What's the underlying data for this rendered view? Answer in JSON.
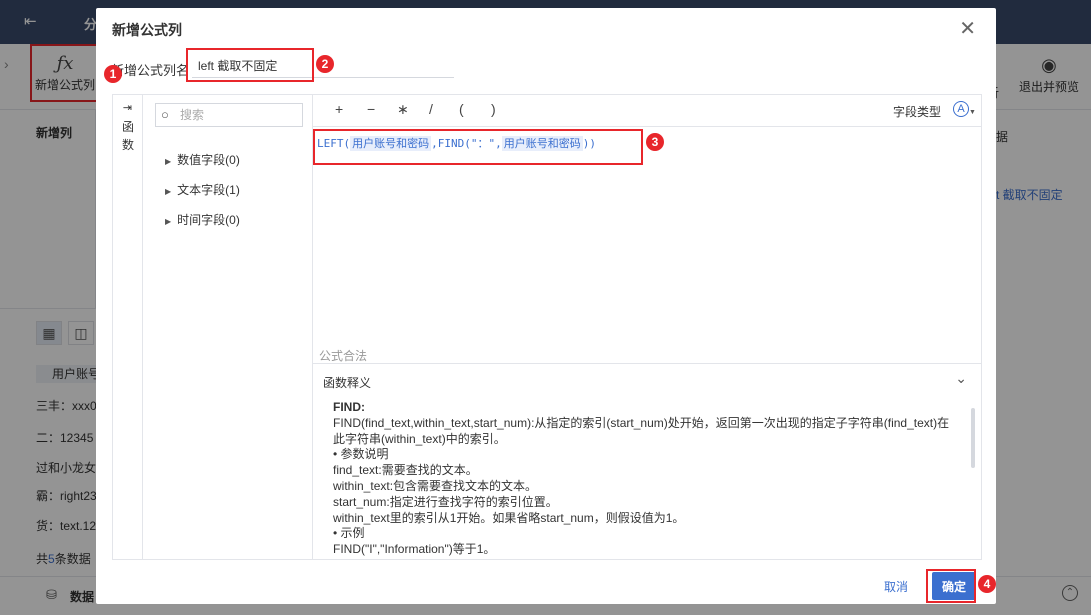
{
  "background": {
    "top_text": "分",
    "toolbar": {
      "new_formula_label": "新增公式列",
      "exit_preview_label": "退出并预览",
      "partial_label": "析"
    },
    "left_panel": {
      "title": "新增列",
      "column_header": "用户账号",
      "rows": [
        "三丰：xxx0",
        "二：12345",
        "过和小龙女",
        "霸：right23",
        "货：text.12"
      ],
      "count_prefix": "共",
      "count_num": "5",
      "count_suffix": "条数据"
    },
    "right_panel": {
      "label1": "据",
      "label2": "t 截取不固定"
    },
    "bottom": {
      "label": "数据"
    }
  },
  "modal": {
    "title": "新增公式列",
    "name_label": "新增公式列名",
    "name_value": "left 截取不固定",
    "functions_tab": "函数",
    "search_placeholder": "搜索",
    "tree": [
      {
        "label": "数值字段(0)"
      },
      {
        "label": "文本字段(1)"
      },
      {
        "label": "时间字段(0)"
      }
    ],
    "operators": [
      "+",
      "−",
      "∗",
      "/",
      "(",
      ")"
    ],
    "field_type_label": "字段类型",
    "formula": {
      "fn1": "LEFT(",
      "field1": "用户账号和密码",
      "mid": ",FIND(",
      "str": "\"：\",",
      "field2": "用户账号和密码",
      "end": "))"
    },
    "valid_text": "公式合法",
    "explain_title": "函数释义",
    "explain": {
      "name": "FIND:",
      "lines": [
        "FIND(find_text,within_text,start_num):从指定的索引(start_num)处开始，返回第一次出现的指定子字符串(find_text)在",
        "此字符串(within_text)中的索引。",
        "• 参数说明",
        "find_text:需要查找的文本。",
        "within_text:包含需要查找文本的文本。",
        "start_num:指定进行查找字符的索引位置。",
        "within_text里的索引从1开始。如果省略start_num，则假设值为1。",
        "• 示例",
        "FIND(\"I\",\"Information\")等于1。"
      ]
    },
    "cancel_label": "取消",
    "ok_label": "确定"
  },
  "badges": [
    "1",
    "2",
    "3",
    "4"
  ],
  "colors": {
    "accent": "#3b6fcf",
    "highlight": "#e8262b"
  }
}
